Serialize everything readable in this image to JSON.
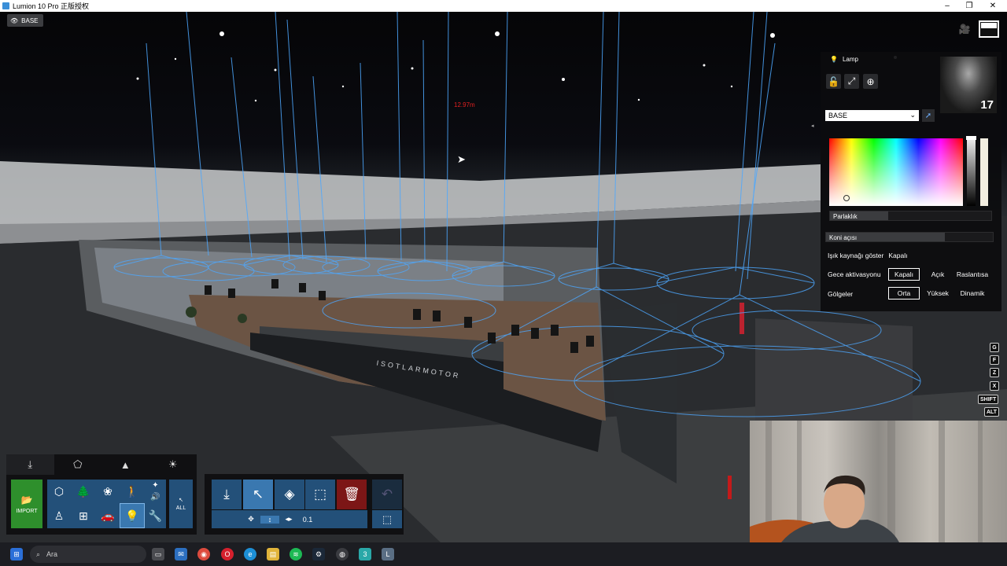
{
  "window": {
    "title": "Lumion 10 Pro 正版授权",
    "minimize": "–",
    "maximize": "❐",
    "close": "✕"
  },
  "viewport": {
    "base_tag": "BASE",
    "distance_readout": "12.97m",
    "sign_text": "ISOTLARMOTOR",
    "icons": {
      "camera": "video-camera-icon",
      "fullscreen": "fullscreen-icon",
      "cursor": "mouse-cursor"
    }
  },
  "properties_panel": {
    "object_name": "Lamp",
    "layer_select": "BASE",
    "count": "17",
    "brightness_label": "Parlaklık",
    "brightness_value": 0.36,
    "cone_angle_label": "Koni açısı",
    "cone_angle_value": 0.71,
    "show_source": {
      "label": "Işık kaynağı göster",
      "value": "Kapalı"
    },
    "night_activation": {
      "label": "Gece aktivasyonu",
      "options": [
        "Kapalı",
        "Açık",
        "Raslantısa"
      ],
      "selected": 0
    },
    "shadows": {
      "label": "Gölgeler",
      "options": [
        "Orta",
        "Yüksek",
        "Dinamik"
      ],
      "selected": 0
    },
    "light_color": "#f2eee0"
  },
  "shortcut_keys": [
    "G",
    "F",
    "Z",
    "X",
    "SHIFT",
    "ALT"
  ],
  "object_library": {
    "tabs": [
      "import-tab",
      "materials-tab",
      "landscape-tab",
      "weather-tab"
    ],
    "import_label": "IMPORT",
    "categories": [
      "nature",
      "indoor",
      "trees",
      "nature-add",
      "people",
      "effects",
      "chair",
      "fence",
      "car",
      "light",
      "sound",
      "utilities"
    ],
    "all_label": "ALL"
  },
  "placement_tools": {
    "sub_values": [
      "✥",
      "↕",
      "◂▸",
      "0.1"
    ]
  },
  "taskbar": {
    "search_placeholder": "Ara"
  }
}
